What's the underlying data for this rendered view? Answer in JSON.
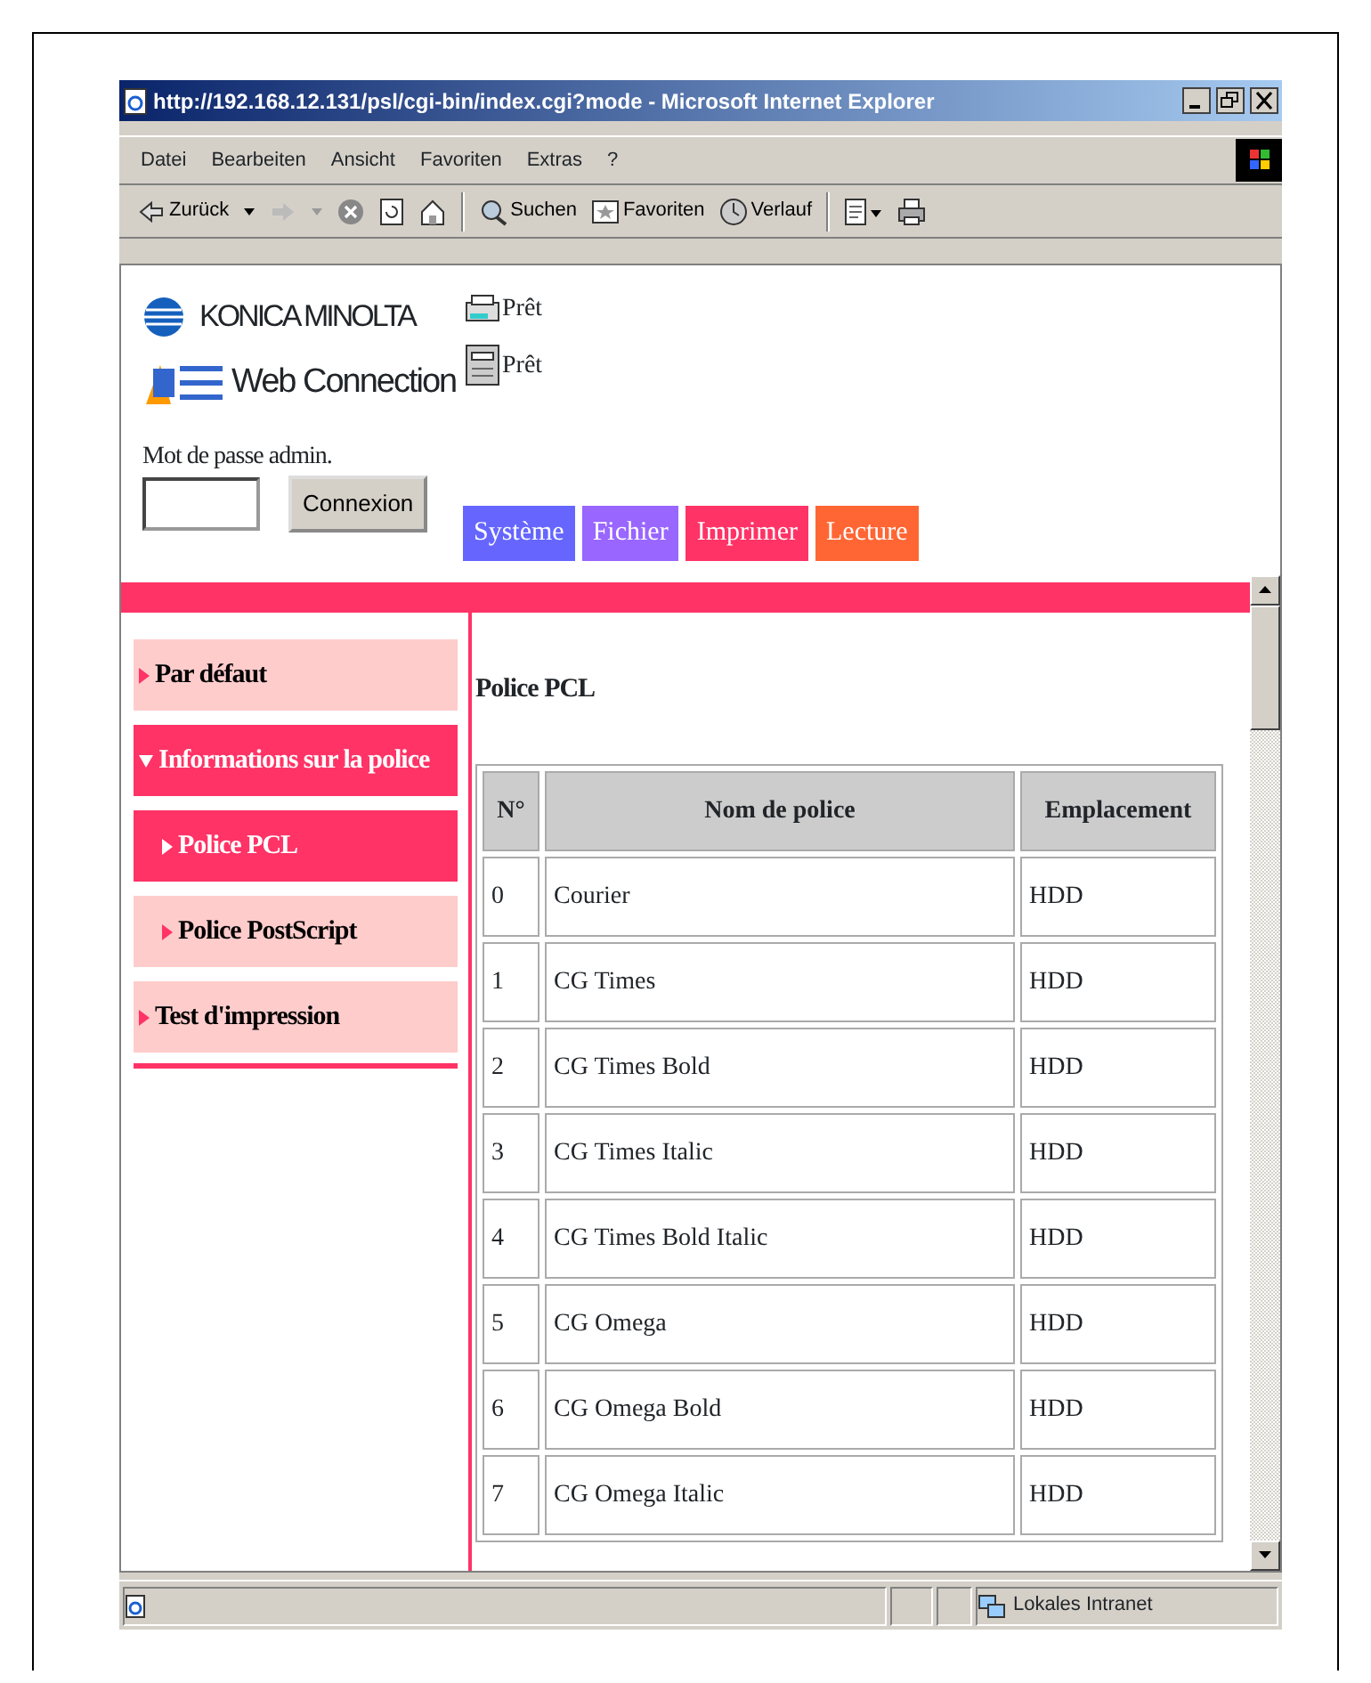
{
  "window": {
    "title": "http://192.168.12.131/psl/cgi-bin/index.cgi?mode - Microsoft Internet Explorer"
  },
  "menu": [
    "Datei",
    "Bearbeiten",
    "Ansicht",
    "Favoriten",
    "Extras",
    "?"
  ],
  "toolbar": [
    {
      "kind": "back",
      "label": "Zurück"
    },
    {
      "kind": "search",
      "label": "Suchen"
    },
    {
      "kind": "favorites",
      "label": "Favoriten"
    },
    {
      "kind": "history",
      "label": "Verlauf"
    }
  ],
  "header": {
    "brand": "KONICA MINOLTA",
    "product": "Web Connection",
    "statuses": [
      "Prêt",
      "Prêt"
    ],
    "password_label": "Mot de passe admin.",
    "login_button": "Connexion"
  },
  "tabs": [
    {
      "label": "Système",
      "color": "#6666ff"
    },
    {
      "label": "Fichier",
      "color": "#9966ff"
    },
    {
      "label": "Imprimer",
      "color": "#ff3366"
    },
    {
      "label": "Lecture",
      "color": "#ff6633"
    }
  ],
  "sidebar": {
    "items": [
      {
        "label": "Par défaut",
        "expanded": false,
        "selected": false
      },
      {
        "label": "Informations sur la police",
        "expanded": true,
        "selected": true,
        "children": [
          {
            "label": "Police PCL",
            "selected": true
          },
          {
            "label": "Police PostScript",
            "selected": false
          }
        ]
      },
      {
        "label": "Test d'impression",
        "expanded": false,
        "selected": false
      }
    ]
  },
  "main": {
    "heading": "Police PCL",
    "table": {
      "columns": [
        "N°",
        "Nom de police",
        "Emplacement"
      ],
      "rows": [
        [
          "0",
          "Courier",
          "HDD"
        ],
        [
          "1",
          "CG Times",
          "HDD"
        ],
        [
          "2",
          "CG Times Bold",
          "HDD"
        ],
        [
          "3",
          "CG Times Italic",
          "HDD"
        ],
        [
          "4",
          "CG Times Bold Italic",
          "HDD"
        ],
        [
          "5",
          "CG Omega",
          "HDD"
        ],
        [
          "6",
          "CG Omega Bold",
          "HDD"
        ],
        [
          "7",
          "CG Omega Italic",
          "HDD"
        ]
      ]
    }
  },
  "status_bar": {
    "zone": "Lokales Intranet"
  }
}
